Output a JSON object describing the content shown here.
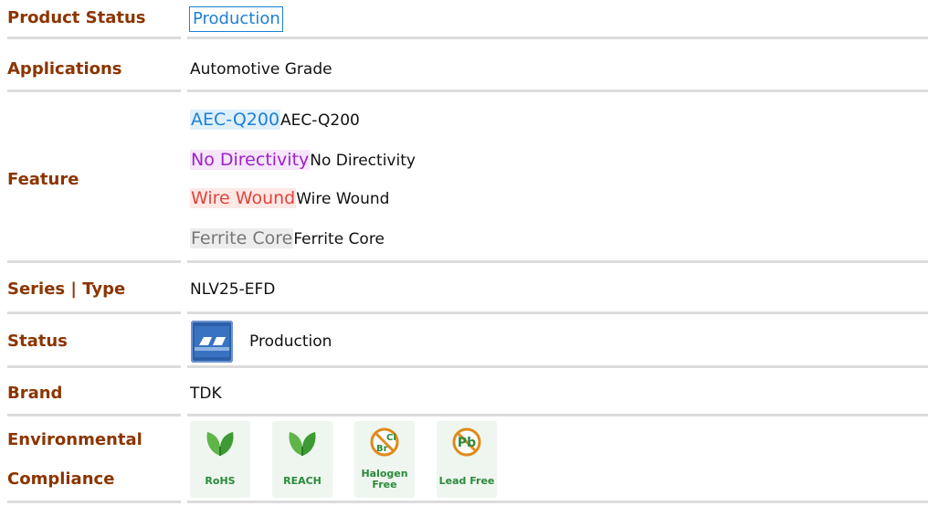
{
  "rows": {
    "product_status": {
      "label": "Product Status",
      "value": "Production"
    },
    "applications": {
      "label": "Applications",
      "value": "Automotive Grade"
    },
    "feature": {
      "label": "Feature",
      "items": [
        {
          "tag": "AEC-Q200",
          "text": "AEC-Q200"
        },
        {
          "tag": "No Directivity",
          "text": "No Directivity"
        },
        {
          "tag": "Wire Wound",
          "text": "Wire Wound"
        },
        {
          "tag": "Ferrite Core",
          "text": "Ferrite Core"
        }
      ]
    },
    "series_type": {
      "label": "Series | Type",
      "value": "NLV25-EFD"
    },
    "status": {
      "label": "Status",
      "value": "Production"
    },
    "brand": {
      "label": "Brand",
      "value": "TDK"
    },
    "environmental": {
      "label_line1": "Environmental",
      "label_line2": "Compliance",
      "badges": [
        {
          "label": "RoHS",
          "icon": "leaf-icon"
        },
        {
          "label": "REACH",
          "icon": "leaf-icon"
        },
        {
          "label_line1": "Halogen",
          "label_line2": "Free",
          "icon": "halogen-free-icon",
          "icon_text_top": "Cl",
          "icon_text_bottom": "Br"
        },
        {
          "label": "Lead Free",
          "icon": "lead-free-icon",
          "icon_text": "Pb"
        }
      ]
    }
  },
  "colors": {
    "label": "#8b3500",
    "link_blue": "#1e7fd6",
    "aec": "#1e7fd6",
    "no_directivity": "#a020c8",
    "wire_wound": "#e0443a",
    "ferrite": "#777777",
    "badge_green": "#2a8a3a",
    "badge_orange": "#e08a1a"
  }
}
